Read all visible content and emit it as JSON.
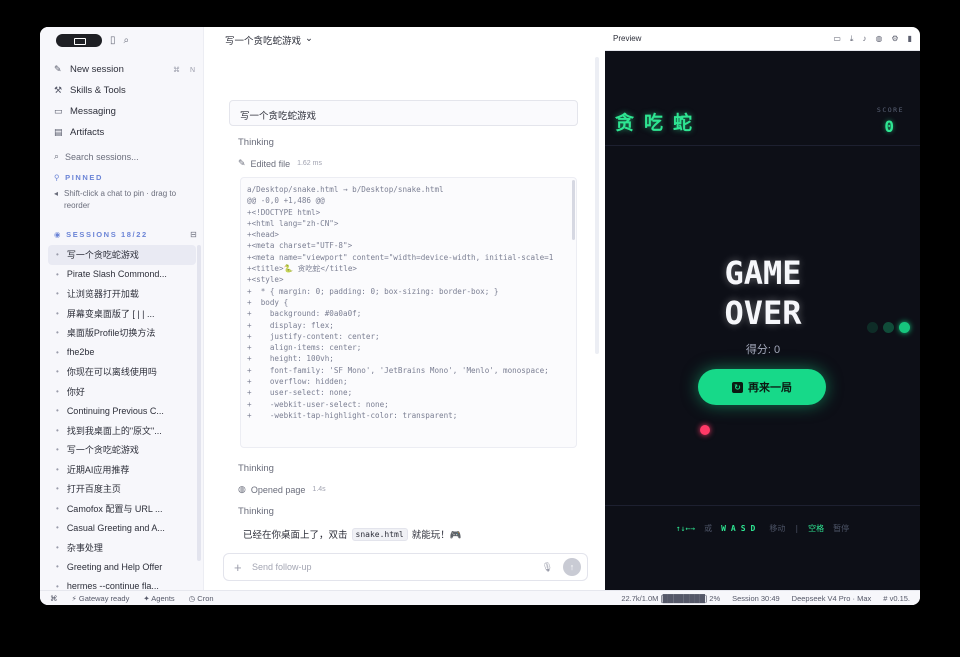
{
  "sidebar": {
    "nav": [
      {
        "icon": "new-session-icon",
        "label": "New session",
        "shortcut": "⌘ N"
      },
      {
        "icon": "skills-icon",
        "label": "Skills & Tools"
      },
      {
        "icon": "messaging-icon",
        "label": "Messaging"
      },
      {
        "icon": "artifacts-icon",
        "label": "Artifacts"
      }
    ],
    "search_placeholder": "Search sessions...",
    "pinned_label": "PINNED",
    "pinned_hint": "Shift-click a chat to pin · drag to reorder",
    "sessions_label": "SESSIONS 18/22",
    "sessions": [
      "写一个贪吃蛇游戏",
      "Pirate Slash Commond...",
      "让浏览器打开加载",
      "屏幕变桌面版了 [ | | ...",
      "桌面版Profile切换方法",
      "fhe2be",
      "你现在可以离线使用吗",
      "你好",
      "Continuing Previous C...",
      "找到我桌面上的\"原文\"...",
      "写一个贪吃蛇游戏",
      "近期AI应用推荐",
      "打开百度主页",
      "Camofox 配置与 URL ...",
      "Casual Greeting and A...",
      "杂事处理",
      "Greeting and Help Offer",
      "hermes --continue fla..."
    ]
  },
  "main": {
    "title": "写一个贪吃蛇游戏",
    "prompt": "写一个贪吃蛇游戏",
    "thinking": "Thinking",
    "edited": "Edited file",
    "edited_time": "1.62 ms",
    "code_lines": [
      "a/Desktop/snake.html → b/Desktop/snake.html",
      "@@ -0,0 +1,486 @@",
      "+<!DOCTYPE html>",
      "+<html lang=\"zh-CN\">",
      "+<head>",
      "+<meta charset=\"UTF-8\">",
      "+<meta name=\"viewport\" content=\"width=device-width, initial-scale=1",
      "+<title>🐍 贪吃蛇</title>",
      "+<style>",
      "+  * { margin: 0; padding: 0; box-sizing: border-box; }",
      "+  body {",
      "+    background: #0a0a0f;",
      "+    display: flex;",
      "+    justify-content: center;",
      "+    align-items: center;",
      "+    height: 100vh;",
      "+    font-family: 'SF Mono', 'JetBrains Mono', 'Menlo', monospace;",
      "+    overflow: hidden;",
      "+    user-select: none;",
      "+    -webkit-user-select: none;",
      "+    -webkit-tap-highlight-color: transparent;"
    ],
    "opened": "Opened page",
    "opened_time": "1.4s",
    "answer_before": "已经在你桌面上了，双击",
    "answer_code": "snake.html",
    "answer_after": "就能玩！🎮",
    "composer_placeholder": "Send follow-up"
  },
  "preview": {
    "label": "Preview",
    "game_title": "贪吃蛇",
    "score_label": "SCORE",
    "score_value": "0",
    "game_over_line1": "GAME",
    "game_over_line2": "OVER",
    "final_score": "得分: 0",
    "restart_label": "再来一局",
    "ctrl_arrows": "↑↓←→",
    "ctrl_or": "或",
    "ctrl_wasd": "WASD",
    "ctrl_move": "移动",
    "ctrl_sep": "|",
    "ctrl_space": "空格",
    "ctrl_pause": "暂停"
  },
  "status": {
    "gateway": "Gateway ready",
    "agents": "Agents",
    "cron": "Cron",
    "context": "22.7k/1.0M [████████] 2%",
    "session": "Session 30:49",
    "model": "Deepseek V4 Pro · Max",
    "version": "v0.15."
  },
  "colors": {
    "accent": "#2ee592",
    "button": "#17d989",
    "food": "#ff3a67",
    "section": "#6b84d6"
  }
}
